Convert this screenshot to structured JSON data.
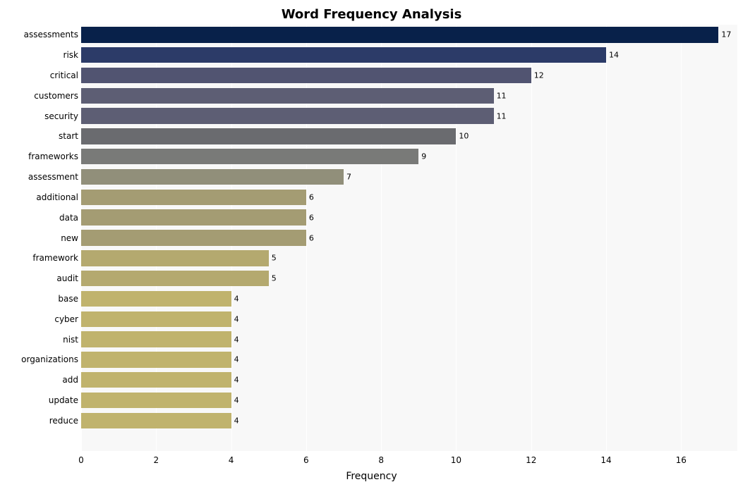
{
  "chart_data": {
    "type": "bar",
    "orientation": "horizontal",
    "title": "Word Frequency Analysis",
    "xlabel": "Frequency",
    "ylabel": "",
    "xlim": [
      0,
      17.5
    ],
    "xticks": [
      0,
      2,
      4,
      6,
      8,
      10,
      12,
      14,
      16
    ],
    "categories": [
      "assessments",
      "risk",
      "critical",
      "customers",
      "security",
      "start",
      "frameworks",
      "assessment",
      "additional",
      "data",
      "new",
      "framework",
      "audit",
      "base",
      "cyber",
      "nist",
      "organizations",
      "add",
      "update",
      "reduce"
    ],
    "values": [
      17,
      14,
      12,
      11,
      11,
      10,
      9,
      7,
      6,
      6,
      6,
      5,
      5,
      4,
      4,
      4,
      4,
      4,
      4,
      4
    ],
    "colors": [
      "#08214a",
      "#2c3b68",
      "#515471",
      "#5d5e74",
      "#5d5e74",
      "#6a6b6f",
      "#797a78",
      "#918f7a",
      "#a49c73",
      "#a49c73",
      "#a49c73",
      "#b4a96f",
      "#b4a96f",
      "#c0b36d",
      "#c0b36d",
      "#c0b36d",
      "#c0b36d",
      "#c0b36d",
      "#c0b36d",
      "#c0b36d"
    ]
  }
}
